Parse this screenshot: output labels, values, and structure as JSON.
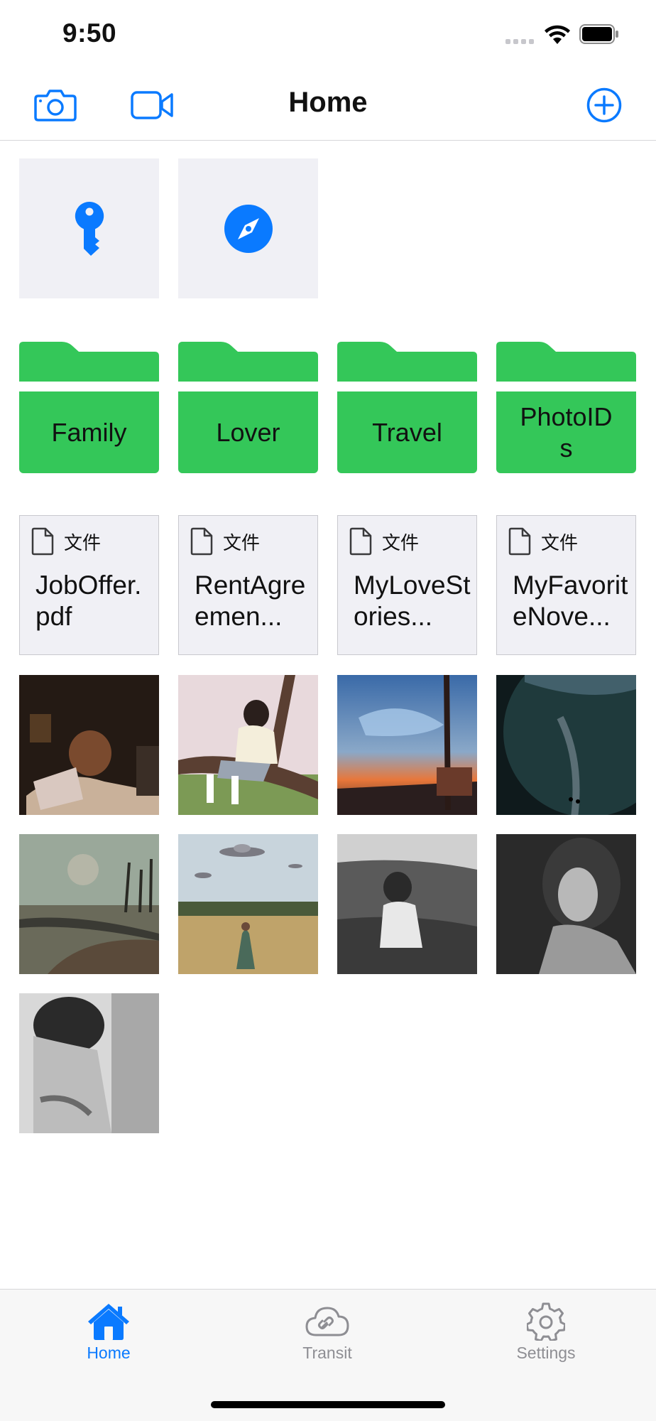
{
  "status": {
    "time": "9:50"
  },
  "nav": {
    "title": "Home"
  },
  "folders": [
    {
      "label": "Family"
    },
    {
      "label": "Lover"
    },
    {
      "label": "Travel"
    },
    {
      "label": "PhotoIDs"
    }
  ],
  "documents": [
    {
      "kind": "文件",
      "name": "JobOffer.pdf"
    },
    {
      "kind": "文件",
      "name": "RentAgreemen..."
    },
    {
      "kind": "文件",
      "name": "MyLoveStories..."
    },
    {
      "kind": "文件",
      "name": "MyFavoriteNove..."
    }
  ],
  "tabs": [
    {
      "label": "Home",
      "selected": true
    },
    {
      "label": "Transit",
      "selected": false
    },
    {
      "label": "Settings",
      "selected": false
    }
  ],
  "colors": {
    "accent": "#0a7aff",
    "folder": "#34c759",
    "tile_bg": "#f0f0f5",
    "tab_inactive": "#8e8e93"
  }
}
